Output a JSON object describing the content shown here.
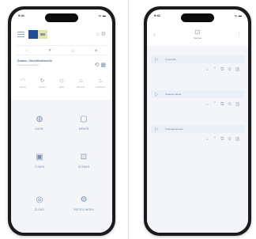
{
  "left_phone": {
    "status": {
      "time": "9:41",
      "icons": "▪ᵢₗ ▬"
    },
    "header": {
      "menu_icon": "hamburger-icon",
      "actions": "⌂ ⚙"
    },
    "tabs": [
      "⌂",
      "▼",
      "△",
      "◈"
    ],
    "device": {
      "name": "Dusauu_ObeshHeaDewelin",
      "sub": "Cpleaeeasnaiilagnei",
      "actions": "⟲ ▦"
    },
    "quick_actions": [
      {
        "icon": "◠",
        "label": "ACCU"
      },
      {
        "icon": "↻",
        "label": "WAAN"
      },
      {
        "icon": "◇",
        "label": "WAS"
      },
      {
        "icon": "♨",
        "label": "BLUUR"
      },
      {
        "icon": "♨",
        "label": "ACHTUR"
      }
    ],
    "tiles": [
      {
        "icon": "◍",
        "label": "DAGEI"
      },
      {
        "icon": "▢",
        "label": "WEKER"
      },
      {
        "icon": "▣",
        "label": "TIJDEN"
      },
      {
        "icon": "⊡",
        "label": "SCENES"
      },
      {
        "icon": "◎",
        "label": "CLOUD"
      },
      {
        "icon": "⚙",
        "label": "INSTELLINGEN"
      }
    ]
  },
  "right_phone": {
    "status": {
      "time": "9:41",
      "icons": "▪ᵢₗ ▬"
    },
    "header": {
      "back": "‹",
      "title_icon": "⊡",
      "title": "Scenes",
      "menu": "⋮"
    },
    "entries": [
      {
        "icon": "▷",
        "label": "Cooeasalt",
        "actions": "⌄ ⌃ ⧉ ⊘ ▥"
      },
      {
        "icon": "▷",
        "label": "Cieaeennaeaet",
        "actions": "⌄ ⌃ ⧉ ⊘ ▥"
      },
      {
        "icon": "▷",
        "label": "Ciaanaaeaenaes",
        "actions": "⌄ ⌃ ⧉ ⊘ ▥"
      }
    ]
  }
}
